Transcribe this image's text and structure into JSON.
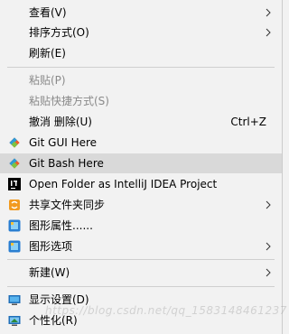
{
  "menu": {
    "view": {
      "label": "查看(V)"
    },
    "sort": {
      "label": "排序方式(O)"
    },
    "refresh": {
      "label": "刷新(E)"
    },
    "paste": {
      "label": "粘贴(P)"
    },
    "paste_shortcut": {
      "label": "粘贴快捷方式(S)"
    },
    "undo_delete": {
      "label": "撤消 删除(U)",
      "shortcut": "Ctrl+Z"
    },
    "git_gui": {
      "label": "Git GUI Here"
    },
    "git_bash": {
      "label": "Git Bash Here"
    },
    "intellij": {
      "label": "Open Folder as IntelliJ IDEA Project"
    },
    "share_sync": {
      "label": "共享文件夹同步"
    },
    "graphics_props": {
      "label": "图形属性......"
    },
    "graphics_opts": {
      "label": "图形选项"
    },
    "new": {
      "label": "新建(W)"
    },
    "display": {
      "label": "显示设置(D)"
    },
    "personalize": {
      "label": "个性化(R)"
    }
  },
  "watermark": "https://blog.csdn.net/qq_1583148461237",
  "colors": {
    "background": "#f2f2f2",
    "hover": "#d9d9d9",
    "disabled_text": "#8a8a8a",
    "separator": "#cfcfcf"
  }
}
